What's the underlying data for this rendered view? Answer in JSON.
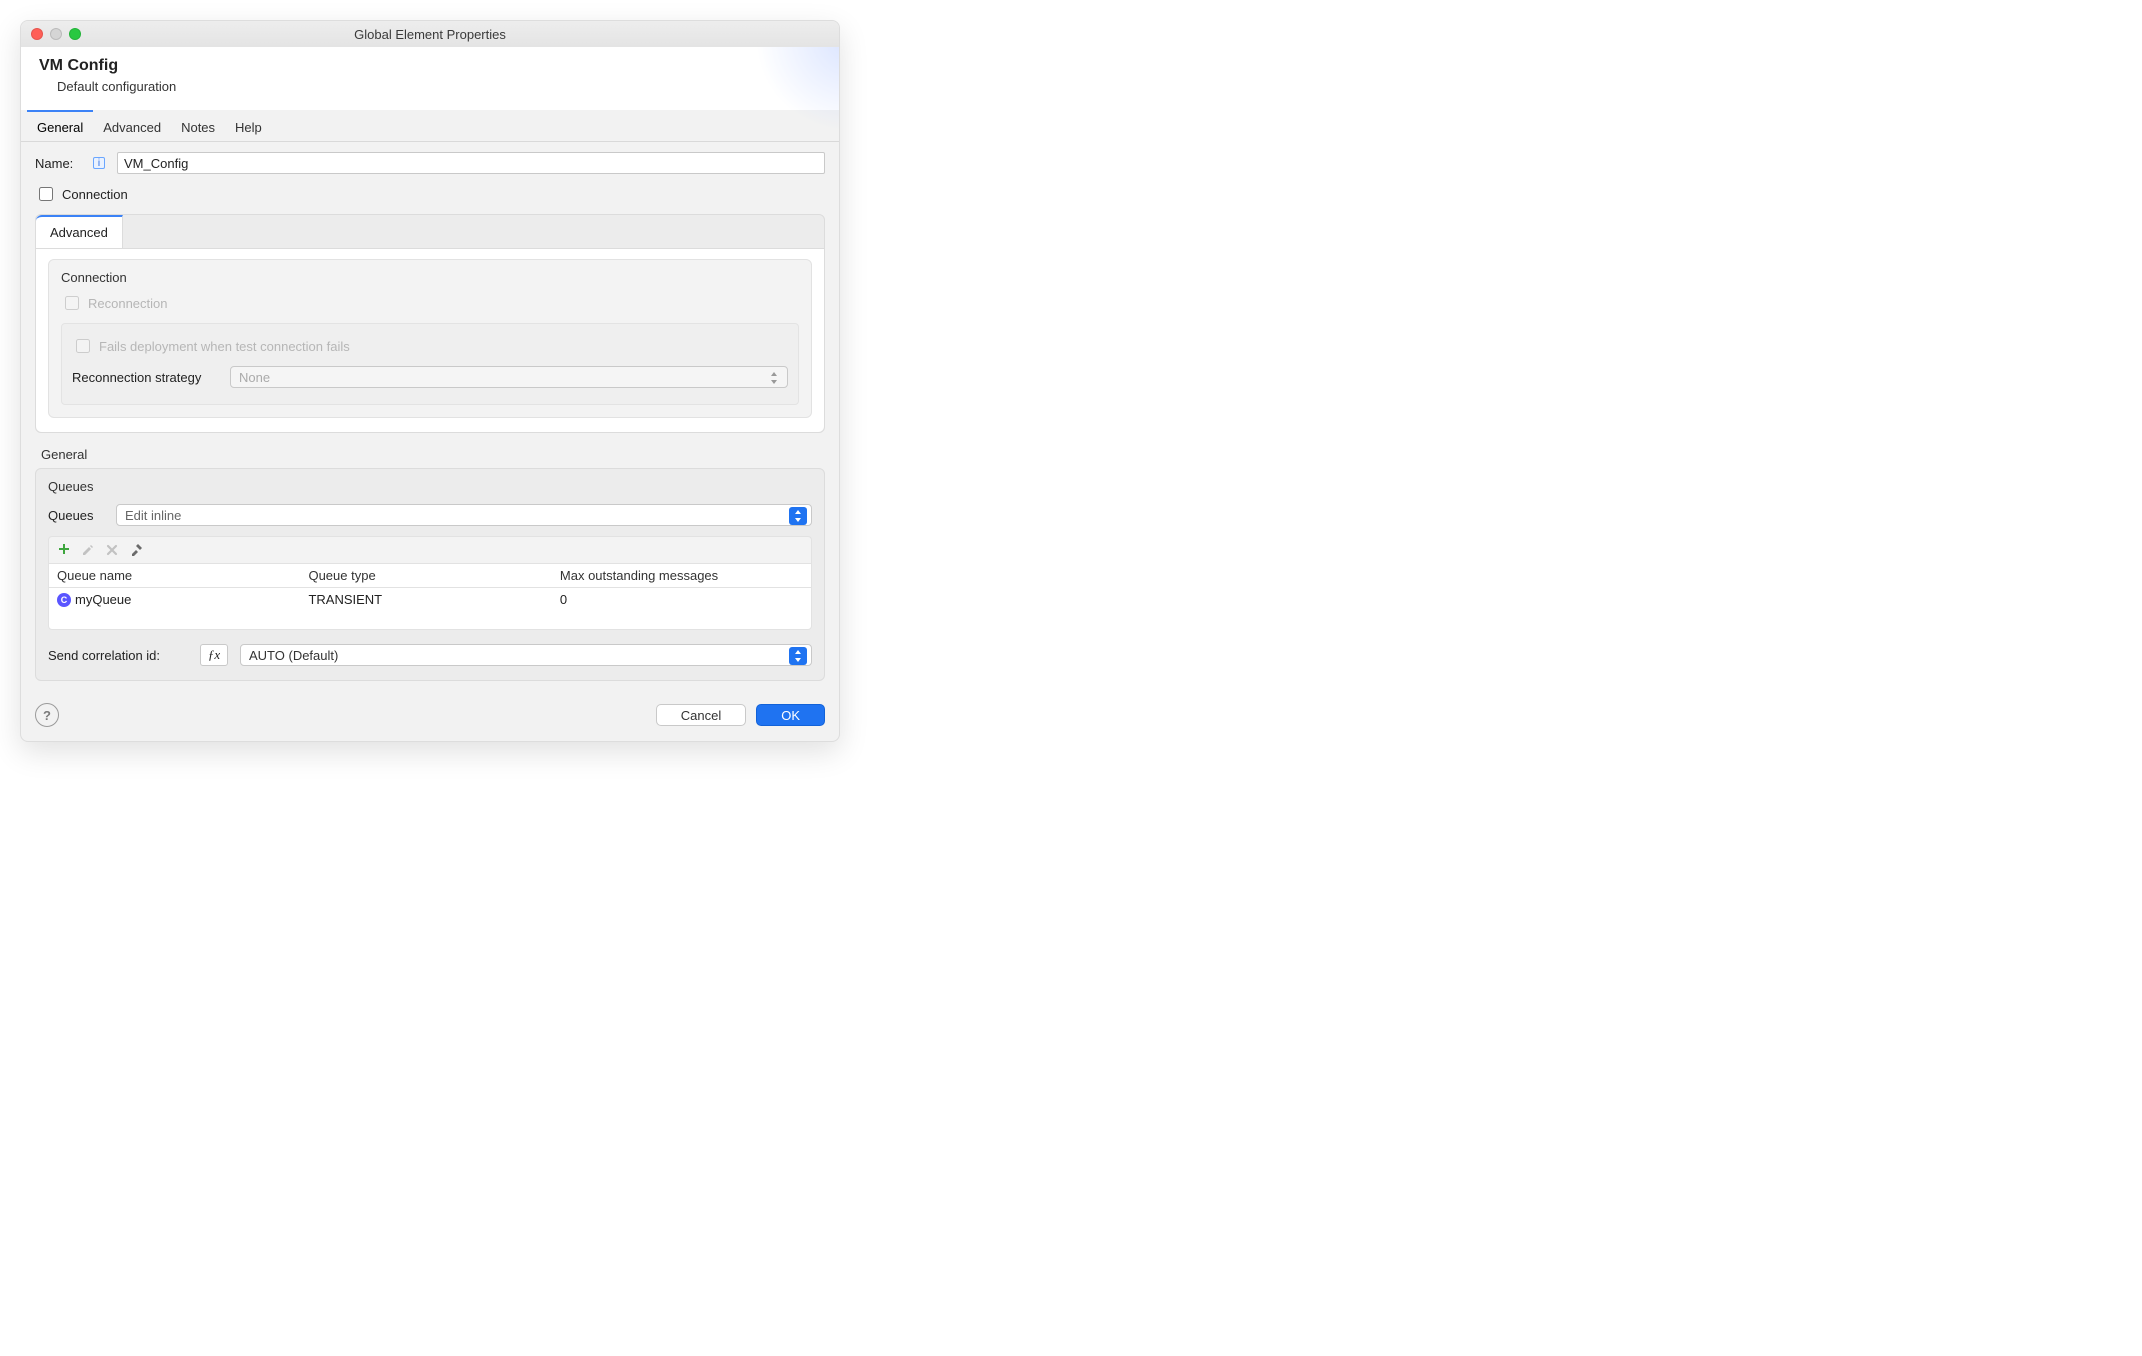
{
  "window_title": "Global Element Properties",
  "header": {
    "title": "VM Config",
    "subtitle": "Default configuration"
  },
  "main_tabs": [
    "General",
    "Advanced",
    "Notes",
    "Help"
  ],
  "form": {
    "name_label": "Name:",
    "name_value": "VM_Config",
    "connection_label": "Connection"
  },
  "inner_tab": "Advanced",
  "connection_group": {
    "title": "Connection",
    "reconnection_label": "Reconnection",
    "fails_label": "Fails deployment when test connection fails",
    "strategy_label": "Reconnection strategy",
    "strategy_value": "None"
  },
  "general_section": {
    "heading": "General",
    "queues_title": "Queues",
    "queues_label": "Queues",
    "queues_mode": "Edit inline",
    "columns": {
      "name": "Queue name",
      "type": "Queue type",
      "max": "Max outstanding messages"
    },
    "rows": [
      {
        "name": "myQueue",
        "type": "TRANSIENT",
        "max": "0"
      }
    ],
    "send_corr_label": "Send correlation id:",
    "send_corr_value": "AUTO (Default)"
  },
  "footer": {
    "cancel": "Cancel",
    "ok": "OK"
  }
}
